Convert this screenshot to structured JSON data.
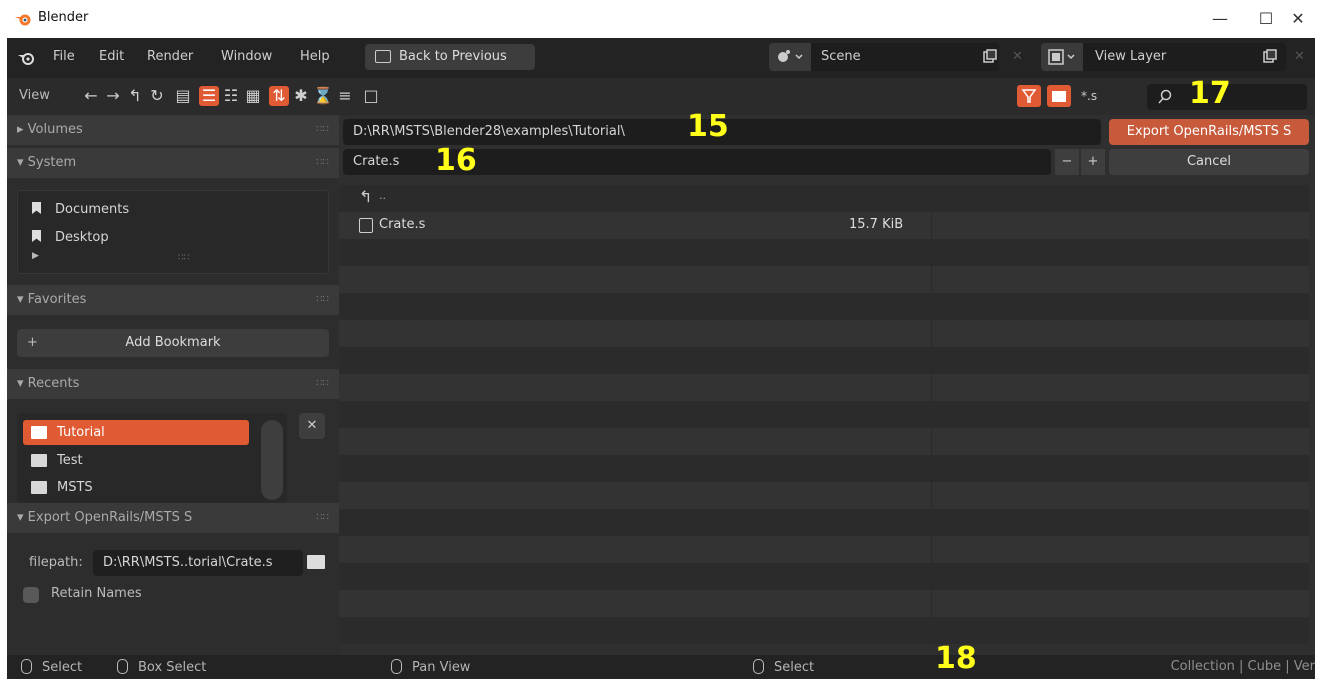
{
  "window": {
    "title": "Blender"
  },
  "menubar": {
    "items": [
      "File",
      "Edit",
      "Render",
      "Window",
      "Help"
    ],
    "back_button": "Back to Previous",
    "scene": "Scene",
    "view_layer": "View Layer"
  },
  "toolbar": {
    "view_label": "View",
    "filter_ext": "*.s",
    "search_placeholder": ""
  },
  "callouts": {
    "path": "15",
    "filename": "16",
    "search": "17",
    "status": "18"
  },
  "left": {
    "volumes": "Volumes",
    "system": "System",
    "system_items": [
      "Documents",
      "Desktop"
    ],
    "favorites": "Favorites",
    "add_bookmark": "Add Bookmark",
    "recents": "Recents",
    "recent_items": [
      "Tutorial",
      "Test",
      "MSTS"
    ],
    "export_panel": "Export OpenRails/MSTS S",
    "filepath_label": "filepath:",
    "filepath_value": "D:\\RR\\MSTS..torial\\Crate.s",
    "retain_names": "Retain Names"
  },
  "main": {
    "directory": "D:\\RR\\MSTS\\Blender28\\examples\\Tutorial\\",
    "filename": "Crate.s",
    "export_button": "Export OpenRails/MSTS S",
    "cancel_button": "Cancel",
    "parent_label": "..",
    "files": [
      {
        "name": "Crate.s",
        "size": "15.7 KiB"
      }
    ]
  },
  "status": {
    "select": "Select",
    "box_select": "Box Select",
    "pan_view": "Pan View",
    "select2": "Select",
    "right": "Collection | Cube | Ver"
  },
  "colors": {
    "accent": "#e05a33",
    "export_button": "#c75a3a",
    "callout": "#ffff1a"
  }
}
